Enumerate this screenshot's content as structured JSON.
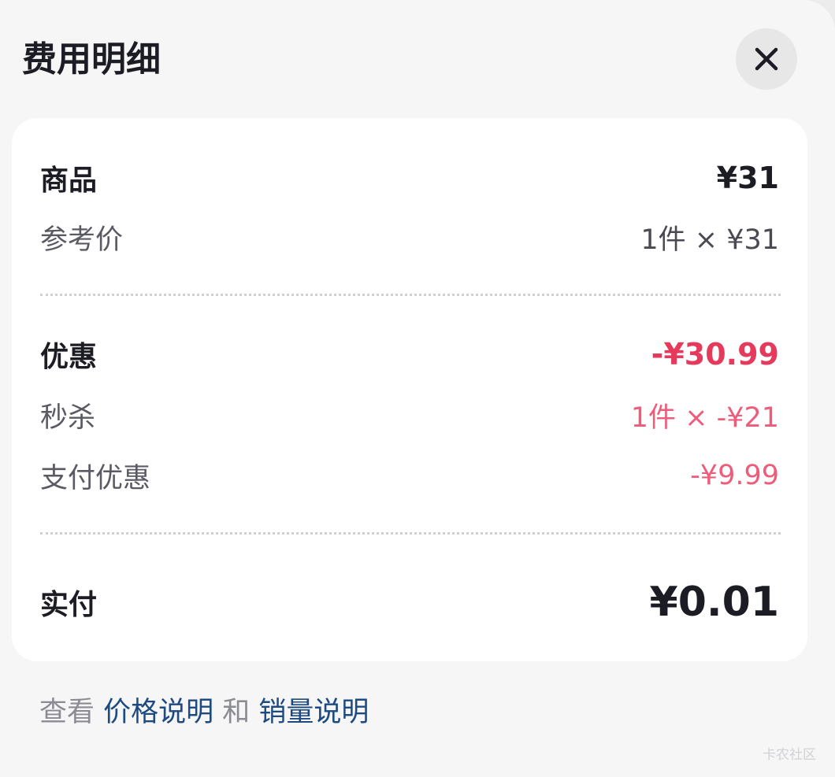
{
  "header": {
    "title": "费用明细"
  },
  "goods": {
    "label": "商品",
    "amount": "¥31",
    "reference_label": "参考价",
    "reference_value": "1件 × ¥31"
  },
  "discount": {
    "label": "优惠",
    "amount": "-¥30.99",
    "flash_sale_label": "秒杀",
    "flash_sale_value": "1件 × -¥21",
    "payment_discount_label": "支付优惠",
    "payment_discount_value": "-¥9.99"
  },
  "total": {
    "label": "实付",
    "amount": "¥0.01"
  },
  "footer": {
    "prefix": "查看 ",
    "price_link": "价格说明",
    "joiner": " 和 ",
    "sales_link": "销量说明"
  },
  "watermark": "卡农社区",
  "colors": {
    "discount_red": "#e63a5c",
    "link_blue": "#1d4a80",
    "text_dark": "#1c1c24"
  },
  "icons": {
    "close": "close-icon"
  }
}
